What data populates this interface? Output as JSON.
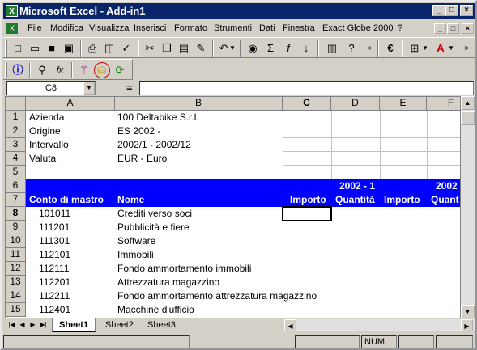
{
  "window": {
    "title": "Microsoft Excel - Add-in1",
    "minimize": "_",
    "maximize": "□",
    "close": "×"
  },
  "menu": {
    "items": [
      "File",
      "Modifica",
      "Visualizza",
      "Inserisci",
      "Formato",
      "Strumenti",
      "Dati",
      "Finestra",
      "Exact Globe 2000",
      "?"
    ]
  },
  "formula_bar": {
    "name_box": "C8",
    "equals": "="
  },
  "columns": [
    "A",
    "B",
    "C",
    "D",
    "E",
    "F"
  ],
  "rows": [
    "1",
    "2",
    "3",
    "4",
    "5",
    "6",
    "7",
    "8",
    "9",
    "10",
    "11",
    "12",
    "13",
    "14",
    "15"
  ],
  "info_rows": [
    {
      "label": "Azienda",
      "value": "100 Deltabike S.r.l."
    },
    {
      "label": "Origine",
      "value": "ES 2002 -"
    },
    {
      "label": "Intervallo",
      "value": "2002/1 - 2002/12"
    },
    {
      "label": "Valuta",
      "value": "EUR - Euro"
    }
  ],
  "header": {
    "period1": "2002 - 1",
    "period2": "2002",
    "col_conto": "Conto di mastro",
    "col_nome": "Nome",
    "col_importo": "Importo",
    "col_quantita": "Quantità",
    "col_importo2": "Importo",
    "col_quant2": "Quant"
  },
  "accounts": [
    {
      "code": "101011",
      "name": "Crediti verso soci"
    },
    {
      "code": "111201",
      "name": "Pubblicità e fiere"
    },
    {
      "code": "111301",
      "name": "Software"
    },
    {
      "code": "112101",
      "name": "Immobili"
    },
    {
      "code": "112111",
      "name": "Fondo ammortamento immobili"
    },
    {
      "code": "112201",
      "name": "Attrezzatura magazzino"
    },
    {
      "code": "112211",
      "name": "Fondo ammortamento attrezzatura magazzino"
    },
    {
      "code": "112401",
      "name": "Macchine d'ufficio"
    }
  ],
  "sheets": [
    "Sheet1",
    "Sheet2",
    "Sheet3"
  ],
  "status": {
    "num": "NUM"
  },
  "colors": {
    "title_bar": "#0a246a",
    "header_band": "#0000ff",
    "excel_green": "#1f7a2e"
  }
}
